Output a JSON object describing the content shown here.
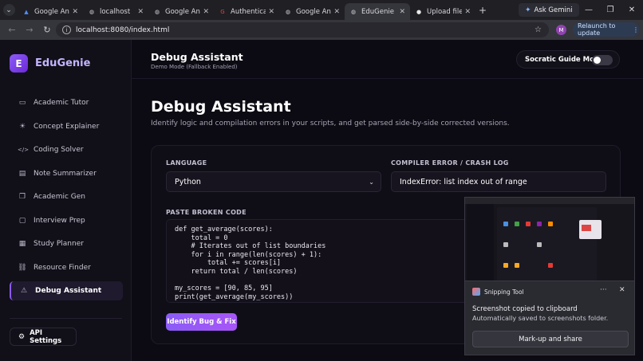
{
  "browser": {
    "tabs": [
      {
        "title": "Google Anti",
        "icon": "antigravity-icon",
        "active": false
      },
      {
        "title": "localhost",
        "icon": "globe-icon",
        "active": false
      },
      {
        "title": "Google Anti",
        "icon": "globe-icon",
        "active": false
      },
      {
        "title": "Authenticati",
        "icon": "google-icon",
        "active": false
      },
      {
        "title": "Google Anti",
        "icon": "globe-icon",
        "active": false
      },
      {
        "title": "EduGenie - A",
        "icon": "globe-icon",
        "active": true
      },
      {
        "title": "Upload files",
        "icon": "github-icon",
        "active": false
      }
    ],
    "ask_gemini": "Ask Gemini",
    "url": "localhost:8080/index.html",
    "profile_initial": "M",
    "relaunch": "Relaunch to update"
  },
  "sidebar": {
    "logo_letter": "E",
    "brand": "EduGenie",
    "items": [
      {
        "label": "Academic Tutor",
        "icon": "book-icon"
      },
      {
        "label": "Concept Explainer",
        "icon": "lightbulb-icon"
      },
      {
        "label": "Coding Solver",
        "icon": "code-icon"
      },
      {
        "label": "Note Summarizer",
        "icon": "document-icon"
      },
      {
        "label": "Academic Gen",
        "icon": "copy-icon"
      },
      {
        "label": "Interview Prep",
        "icon": "chat-icon"
      },
      {
        "label": "Study Planner",
        "icon": "calendar-icon"
      },
      {
        "label": "Resource Finder",
        "icon": "link-icon"
      },
      {
        "label": "Debug Assistant",
        "icon": "warning-icon"
      }
    ],
    "active_index": 8,
    "api_settings": "API Settings"
  },
  "header": {
    "title": "Debug Assistant",
    "subtitle": "Demo Mode (Fallback Enabled)",
    "socratic_label": "Socratic Guide Mode",
    "socratic_enabled": false
  },
  "main": {
    "title": "Debug Assistant",
    "description": "Identify logic and compilation errors in your scripts, and get parsed side-by-side corrected versions.",
    "language_label": "LANGUAGE",
    "language_value": "Python",
    "error_label": "COMPILER ERROR / CRASH LOG",
    "error_value": "IndexError: list index out of range",
    "code_label": "PASTE BROKEN CODE",
    "code": "def get_average(scores):\n    total = 0\n    # Iterates out of list boundaries\n    for i in range(len(scores) + 1):\n        total += scores[i]\n    return total / len(scores)\n\nmy_scores = [90, 85, 95]\nprint(get_average(my_scores))",
    "submit": "Identify Bug & Fix"
  },
  "snipping": {
    "app_name": "Snipping Tool",
    "line1": "Screenshot copied to clipboard",
    "line2": "Automatically saved to screenshots folder.",
    "action": "Mark-up and share"
  }
}
